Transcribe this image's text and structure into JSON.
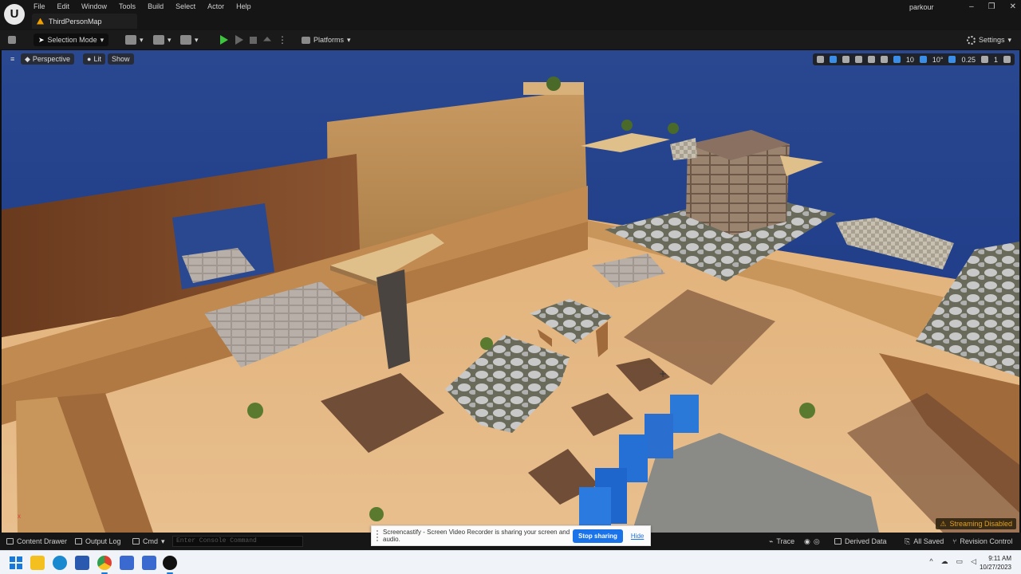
{
  "app": {
    "logo": "U",
    "menu": [
      "File",
      "Edit",
      "Window",
      "Tools",
      "Build",
      "Select",
      "Actor",
      "Help"
    ],
    "tab_title": "ThirdPersonMap",
    "project": "parkour",
    "window_controls": [
      "–",
      "❐",
      "✕"
    ]
  },
  "toolbar": {
    "selection_mode": "Selection Mode",
    "platforms": "Platforms",
    "settings": "Settings"
  },
  "viewport": {
    "perspective": "Perspective",
    "lit": "Lit",
    "show": "Show",
    "grid_snap": "10",
    "rotation_snap": "10°",
    "scale_snap": "0.25",
    "camera_speed": "1",
    "streaming": "Streaming Disabled",
    "axis": "x"
  },
  "statusbar": {
    "content_drawer": "Content Drawer",
    "output_log": "Output Log",
    "cmd": "Cmd",
    "console_placeholder": "Enter Console Command",
    "trace": "Trace",
    "derived_data": "Derived Data",
    "all_saved": "All Saved",
    "revision_control": "Revision Control"
  },
  "share_bar": {
    "message": "Screencastify - Screen Video Recorder is sharing your screen and audio.",
    "stop_label": "Stop sharing",
    "hide_label": "Hide"
  },
  "taskbar": {
    "time": "9:11 AM",
    "date": "10/27/2023",
    "tray_chevron": "^"
  }
}
